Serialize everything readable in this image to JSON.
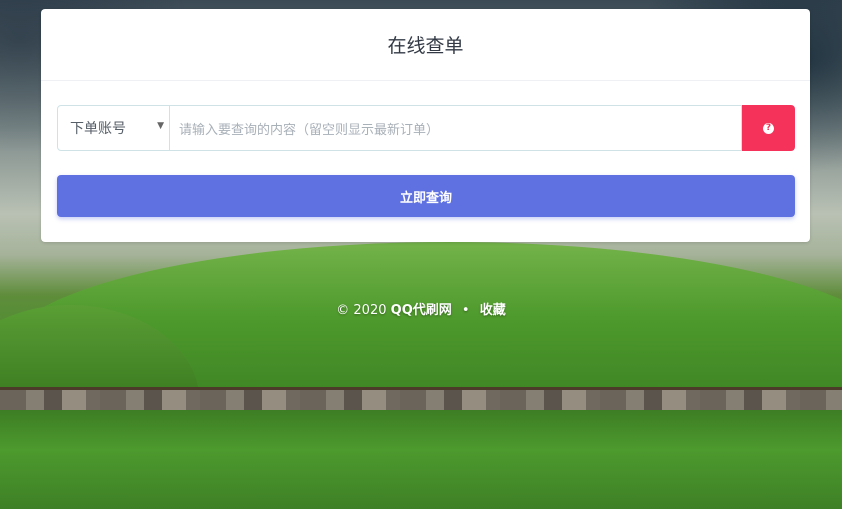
{
  "card": {
    "title": "在线查单"
  },
  "search": {
    "select_value": "下单账号",
    "placeholder": "请输入要查询的内容（留空则显示最新订单）",
    "help_icon": "question-circle-icon",
    "submit_label": "立即查询"
  },
  "footer": {
    "copyright": "© 2020",
    "site_name": "QQ代刷网",
    "separator": "•",
    "bookmark_link": "收藏"
  },
  "colors": {
    "primary_button": "#5f71e1",
    "help_button": "#f5335a"
  }
}
